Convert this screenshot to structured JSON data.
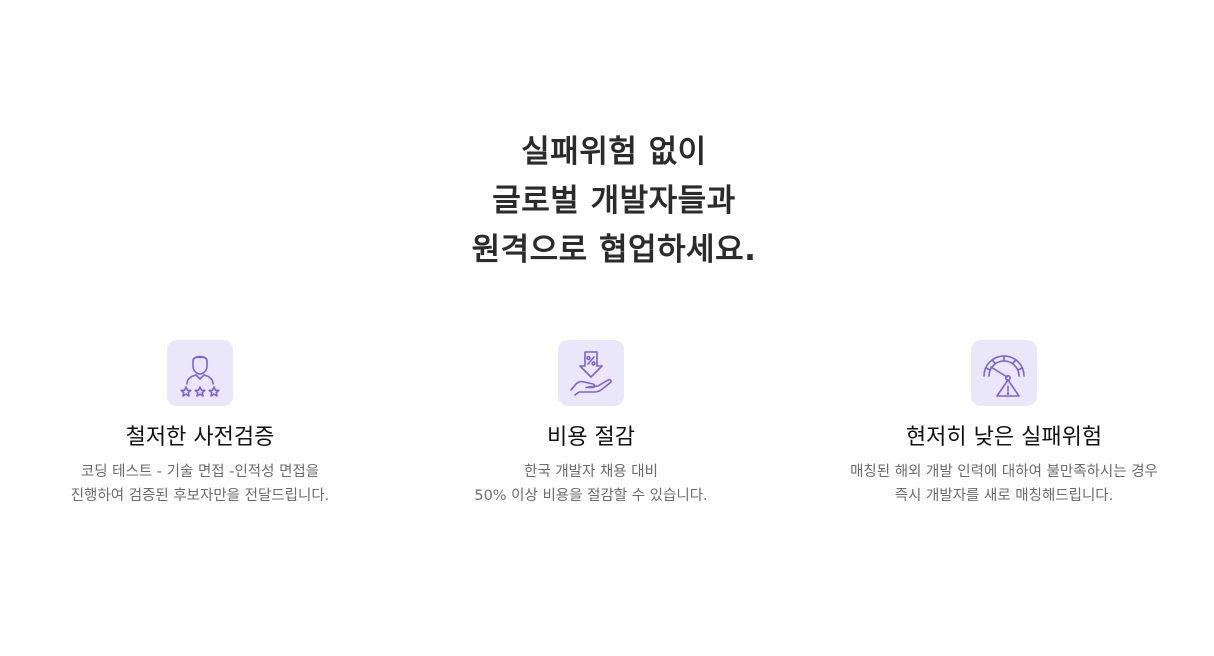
{
  "headline": {
    "line1": "실패위험 없이",
    "line2": "글로벌 개발자들과",
    "line3": "원격으로 협업하세요."
  },
  "features": [
    {
      "icon": "user-rating-icon",
      "title": "철저한 사전검증",
      "desc_line1": "코딩 테스트 - 기술 면접 -인적성 면접을",
      "desc_line2": "진행하여 검증된 후보자만을 전달드립니다."
    },
    {
      "icon": "cost-saving-icon",
      "title": "비용 절감",
      "desc_line1": "한국 개발자 채용 대비",
      "desc_line2": "50% 이상 비용을 절감할 수 있습니다."
    },
    {
      "icon": "risk-gauge-icon",
      "title": "현저히 낮은 실패위험",
      "desc_line1": "매칭된 해외 개발 인력에 대하여 불만족하시는 경우",
      "desc_line2": "즉시 개발자를 새로 매칭해드립니다."
    }
  ],
  "colors": {
    "icon_bg": "#ebe7fb",
    "icon_stroke": "#7a63d6",
    "heading": "#2b2b2b",
    "body_text": "#6b6b6b"
  }
}
